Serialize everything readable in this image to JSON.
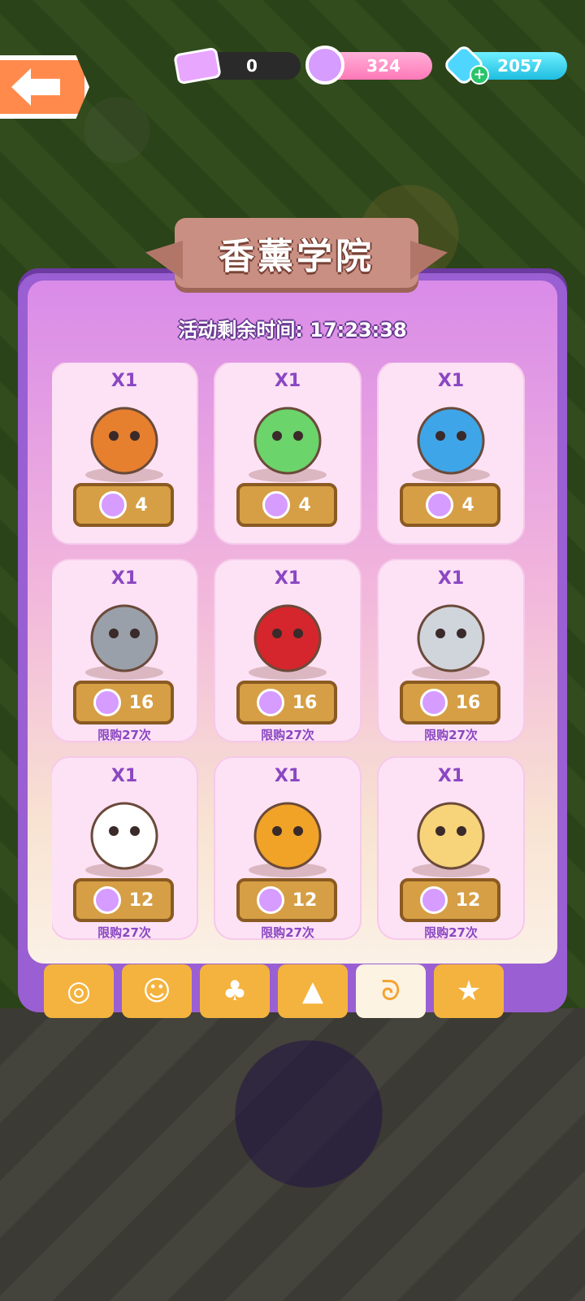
{
  "header": {
    "tickets": "0",
    "feathers": "324",
    "gems": "2057"
  },
  "panel": {
    "title": "香薰学院",
    "timer_label": "活动剩余时间: 17:23:38"
  },
  "items": [
    {
      "qty": "X1",
      "price": "4",
      "limit": "",
      "icon": "mushroom-icon",
      "color": "#e67f2e"
    },
    {
      "qty": "X1",
      "price": "4",
      "limit": "",
      "icon": "paper-frog-icon",
      "color": "#6bd46a"
    },
    {
      "qty": "X1",
      "price": "4",
      "limit": "",
      "icon": "lego-house-icon",
      "color": "#3ea5e8"
    },
    {
      "qty": "X1",
      "price": "16",
      "limit": "限购27次",
      "icon": "raccoon-character-icon",
      "color": "#9aa0aa"
    },
    {
      "qty": "X1",
      "price": "16",
      "limit": "限购27次",
      "icon": "red-hair-cat-character-icon",
      "color": "#d4262c"
    },
    {
      "qty": "X1",
      "price": "16",
      "limit": "限购27次",
      "icon": "bird-character-icon",
      "color": "#cfd5db"
    },
    {
      "qty": "X1",
      "price": "12",
      "limit": "限购27次",
      "icon": "white-duck-character-icon",
      "color": "#ffffff"
    },
    {
      "qty": "X1",
      "price": "12",
      "limit": "限购27次",
      "icon": "orange-lizard-character-icon",
      "color": "#f0a326"
    },
    {
      "qty": "X1",
      "price": "12",
      "limit": "限购27次",
      "icon": "bunny-character-icon",
      "color": "#f7d37a"
    }
  ],
  "tabs": [
    {
      "icon": "swirl-cloud-icon",
      "glyph": "◎"
    },
    {
      "icon": "two-faces-icon",
      "glyph": "☺"
    },
    {
      "icon": "tree-icon",
      "glyph": "♣"
    },
    {
      "icon": "cat-head-icon",
      "glyph": "▲"
    },
    {
      "icon": "snail-bag-icon",
      "glyph": "ᘐ",
      "active": true
    },
    {
      "icon": "star-paw-icon",
      "glyph": "★"
    }
  ]
}
